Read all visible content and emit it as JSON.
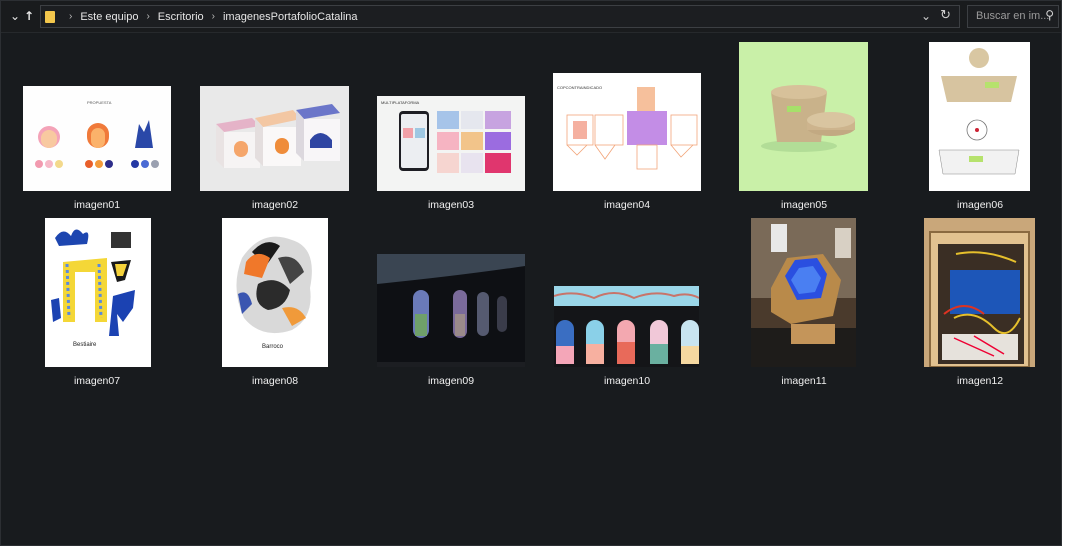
{
  "nav": {
    "back_icon": "chevron-down-icon",
    "up_icon": "up-arrow-icon"
  },
  "breadcrumb": {
    "items": [
      "Este equipo",
      "Escritorio",
      "imagenesPortafolioCatalina"
    ],
    "separator": "›"
  },
  "search": {
    "placeholder": "Buscar en im..."
  },
  "files": [
    {
      "name": "imagen01"
    },
    {
      "name": "imagen02"
    },
    {
      "name": "imagen03"
    },
    {
      "name": "imagen04"
    },
    {
      "name": "imagen05"
    },
    {
      "name": "imagen06"
    },
    {
      "name": "imagen07"
    },
    {
      "name": "imagen08"
    },
    {
      "name": "imagen09"
    },
    {
      "name": "imagen10"
    },
    {
      "name": "imagen11"
    },
    {
      "name": "imagen12"
    }
  ],
  "colors": {
    "window_bg": "#181b1e",
    "text": "#f0f0f0",
    "folder": "#f3c74c"
  }
}
